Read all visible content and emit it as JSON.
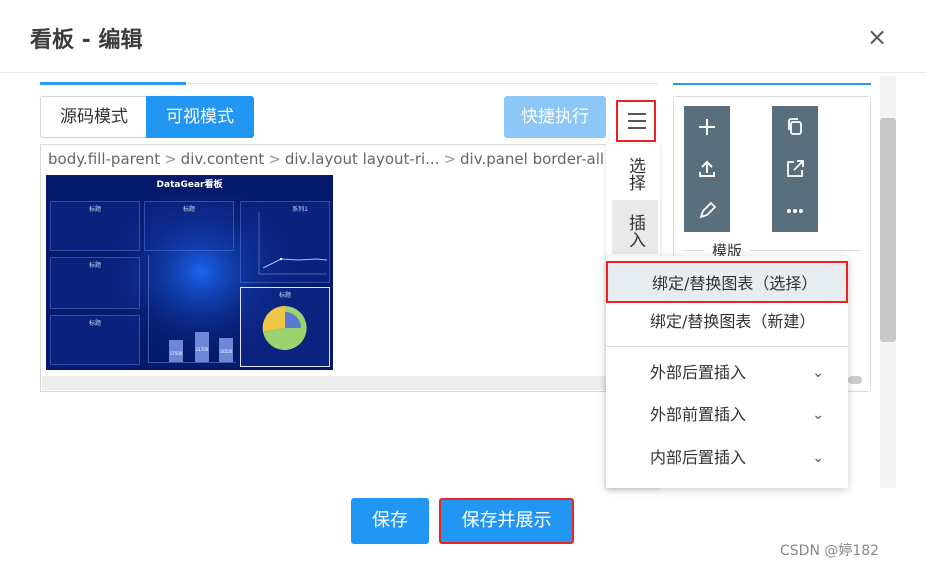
{
  "dialog": {
    "title": "看板 - 编辑",
    "close_symbol": "×"
  },
  "modes": {
    "source": "源码模式",
    "visual": "可视模式",
    "quick_run": "快捷执行"
  },
  "breadcrumb": [
    "body.fill-parent",
    "div.content",
    "div.layout layout-ri...",
    "div.panel border-all"
  ],
  "preview": {
    "title": "DataGear看板",
    "panel_label": "标题",
    "legend_text": "系列1",
    "bar_values": [
      "17500",
      "21700",
      "18500"
    ]
  },
  "side_menu": {
    "select": "选择",
    "insert": "插入"
  },
  "dropdown": {
    "items": [
      {
        "label": "绑定/替换图表（选择）",
        "expandable": false
      },
      {
        "label": "绑定/替换图表（新建）",
        "expandable": false
      },
      {
        "label": "外部后置插入",
        "expandable": true
      },
      {
        "label": "外部前置插入",
        "expandable": true
      },
      {
        "label": "内部后置插入",
        "expandable": true
      }
    ],
    "chevron": "⌄"
  },
  "right_panel": {
    "template_label": "模版",
    "tools": [
      "plus-icon",
      "upload-icon",
      "edit-icon",
      "copy-icon",
      "external-link-icon",
      "more-icon"
    ]
  },
  "footer": {
    "save": "保存",
    "save_and_show": "保存并展示"
  },
  "watermark": "CSDN @婷182",
  "colors": {
    "primary": "#2196f3",
    "highlight_border": "#e22222",
    "tool_bg": "#5a6f7d",
    "preview_bg": "#061a6b"
  }
}
